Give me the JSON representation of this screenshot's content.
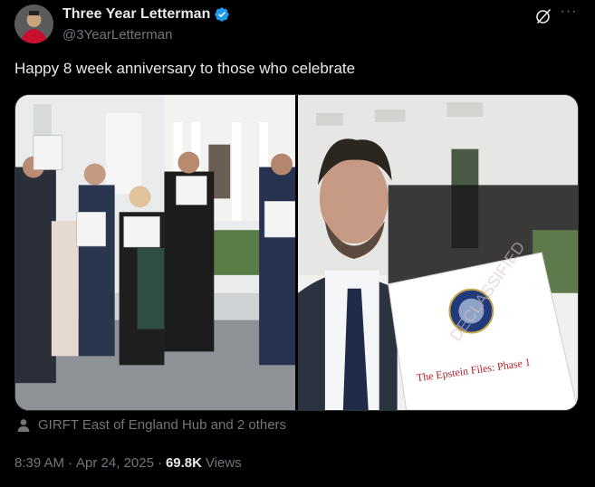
{
  "author": {
    "display_name": "Three Year Letterman",
    "handle": "@3YearLetterman",
    "avatar_icon": "avatar"
  },
  "tweet": {
    "text": "Happy 8 week anniversary to those who celebrate"
  },
  "media": {
    "photo_1_icon": "photo",
    "photo_2_icon": "photo",
    "binder_title": "The Epstein Files: Phase 1",
    "stamp_text": "DECLASSIFIED"
  },
  "tagged": {
    "text": "GIRFT East of England Hub and 2 others",
    "icon": "person-icon"
  },
  "meta": {
    "time": "8:39 AM",
    "separator": "·",
    "date": "Apr 24, 2025",
    "separator2": "·",
    "views_count": "69.8K",
    "views_label": "Views"
  },
  "colors": {
    "background": "#000000",
    "text": "#e7e9ea",
    "secondary": "#71767b",
    "verified": "#1d9bf0"
  }
}
